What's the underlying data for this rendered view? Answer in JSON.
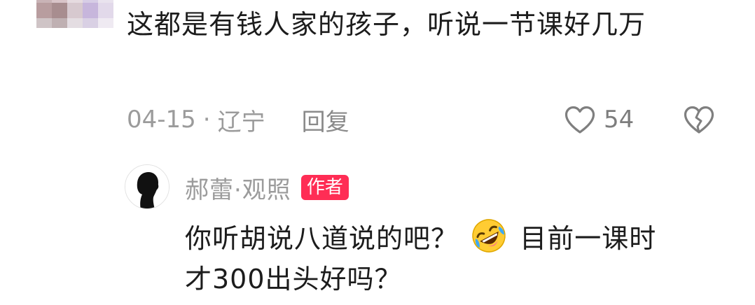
{
  "comment": {
    "text": "这都是有钱人家的孩子，听说一节课好几万",
    "date": "04-15",
    "separator": "·",
    "location": "辽宁",
    "reply_label": "回复",
    "like_count": "54",
    "icons": {
      "like": "heart-outline-icon",
      "dislike": "broken-heart-icon"
    }
  },
  "reply": {
    "author": "郝蕾·观照",
    "badge": "作者",
    "text_part1": "你听胡说八道说的吧？",
    "emoji": "rolling-on-floor-laughing-emoji",
    "text_part2": "目前一课时",
    "text_part3": "才300出头好吗？"
  },
  "colors": {
    "badge_bg": "#ff2d55",
    "meta_text": "#9b9b9b",
    "body_text": "#1c1c1c"
  }
}
